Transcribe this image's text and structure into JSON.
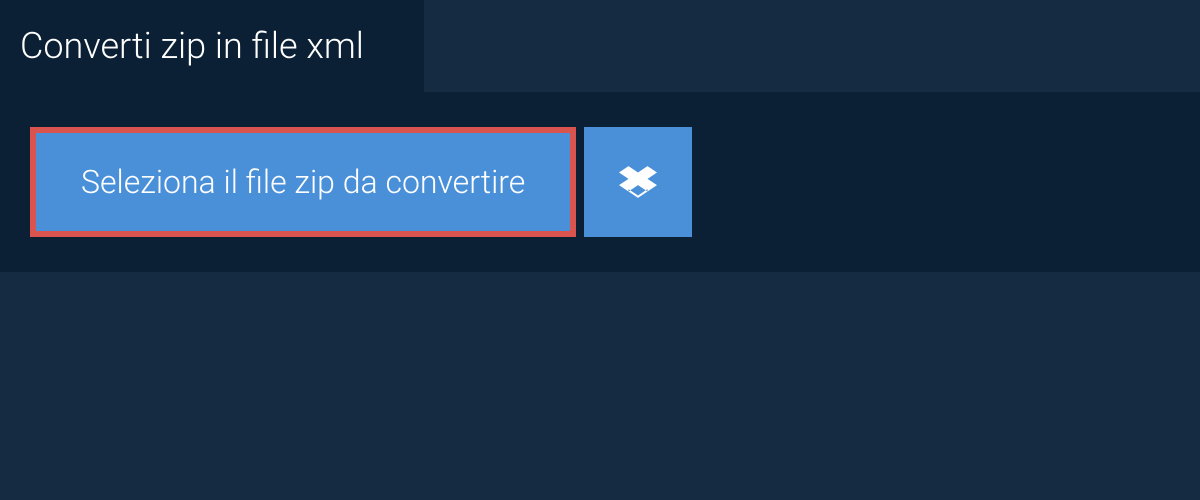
{
  "tab": {
    "title": "Converti zip in file xml"
  },
  "upload": {
    "select_label": "Seleziona il file zip da convertire",
    "dropbox_icon": "dropbox"
  },
  "colors": {
    "background": "#152b42",
    "panel": "#0b2034",
    "button": "#4a90d9",
    "highlight_border": "#d9534f"
  }
}
